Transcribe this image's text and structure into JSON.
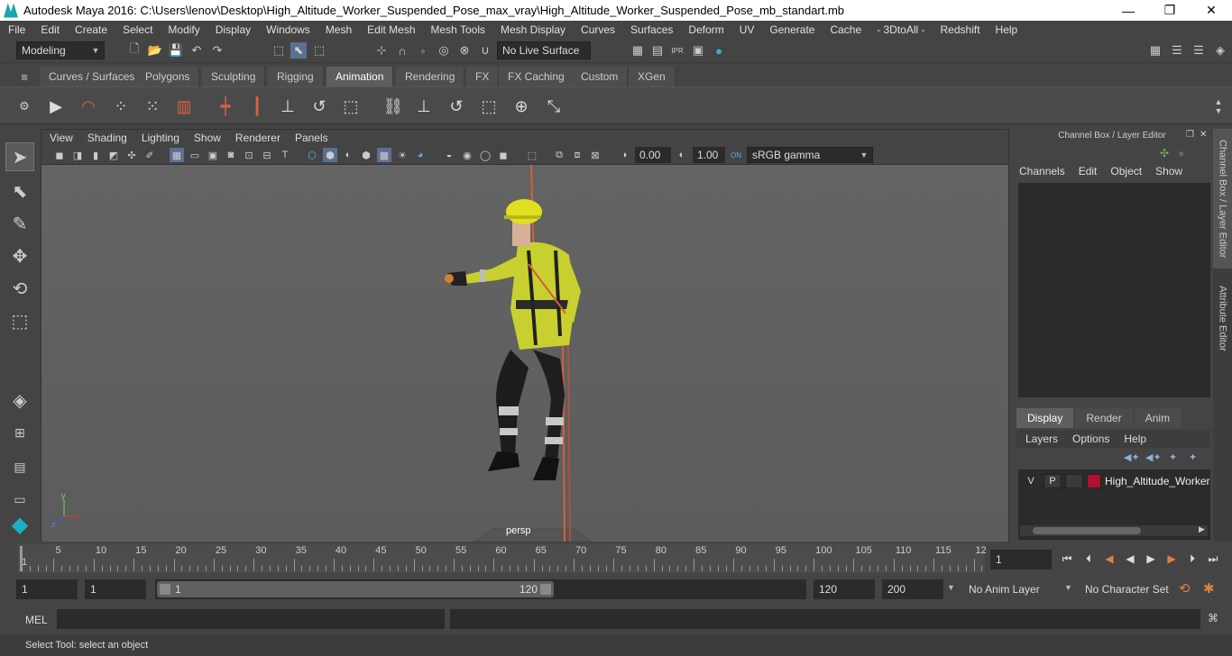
{
  "window": {
    "title": "Autodesk Maya 2016: C:\\Users\\lenov\\Desktop\\High_Altitude_Worker_Suspended_Pose_max_vray\\High_Altitude_Worker_Suspended_Pose_mb_standart.mb",
    "minimize": "—",
    "restore": "❐",
    "close": "✕"
  },
  "menubar": [
    "File",
    "Edit",
    "Create",
    "Select",
    "Modify",
    "Display",
    "Windows",
    "Mesh",
    "Edit Mesh",
    "Mesh Tools",
    "Mesh Display",
    "Curves",
    "Surfaces",
    "Deform",
    "UV",
    "Generate",
    "Cache",
    "- 3DtoAll -",
    "Redshift",
    "Help"
  ],
  "statusline": {
    "mode": "Modeling",
    "live_surface": "No Live Surface"
  },
  "shelf_tabs": [
    {
      "label": "Curves / Surfaces",
      "active": false
    },
    {
      "label": "Polygons",
      "active": false
    },
    {
      "label": "Sculpting",
      "active": false
    },
    {
      "label": "Rigging",
      "active": false
    },
    {
      "label": "Animation",
      "active": true
    },
    {
      "label": "Rendering",
      "active": false
    },
    {
      "label": "FX",
      "active": false
    },
    {
      "label": "FX Caching",
      "active": false
    },
    {
      "label": "Custom",
      "active": false
    },
    {
      "label": "XGen",
      "active": false
    }
  ],
  "viewport": {
    "menu": [
      "View",
      "Shading",
      "Lighting",
      "Show",
      "Renderer",
      "Panels"
    ],
    "exposure": "0.00",
    "gamma": "1.00",
    "color_space": "sRGB gamma",
    "camera_label": "persp"
  },
  "channel_box": {
    "title": "Channel Box / Layer Editor",
    "menu": [
      "Channels",
      "Edit",
      "Object",
      "Show"
    ]
  },
  "layer_editor": {
    "tabs": [
      {
        "label": "Display",
        "active": true
      },
      {
        "label": "Render",
        "active": false
      },
      {
        "label": "Anim",
        "active": false
      }
    ],
    "menu": [
      "Layers",
      "Options",
      "Help"
    ],
    "layer": {
      "v": "V",
      "p": "P",
      "name": "High_Altitude_Worker",
      "color": "#b01030"
    }
  },
  "side_tabs": [
    "Channel Box / Layer Editor",
    "Attribute Editor"
  ],
  "timeline": {
    "labels": [
      "5",
      "10",
      "15",
      "20",
      "25",
      "30",
      "35",
      "40",
      "45",
      "50",
      "55",
      "60",
      "65",
      "70",
      "75",
      "80",
      "85",
      "90",
      "95",
      "100",
      "105",
      "110",
      "115",
      "12"
    ],
    "start_label": "1",
    "current_frame": "1"
  },
  "range": {
    "start": "1",
    "playback_start": "1",
    "slider_start": "1",
    "slider_end": "120",
    "playback_end": "120",
    "end": "200",
    "anim_layer": "No Anim Layer",
    "character_set": "No Character Set"
  },
  "cmdline": {
    "label": "MEL"
  },
  "helpline": {
    "text": "Select Tool: select an object"
  }
}
